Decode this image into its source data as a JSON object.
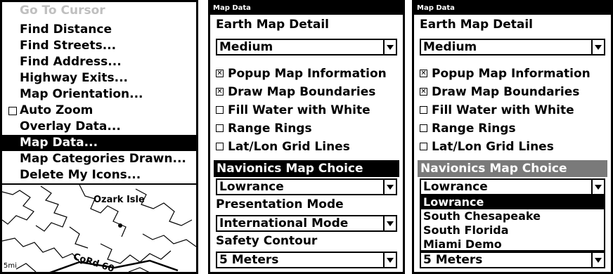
{
  "menu": {
    "items": [
      {
        "label": "Go To Cursor",
        "state": "disabled"
      },
      {
        "label": "Find Distance"
      },
      {
        "label": "Find Streets..."
      },
      {
        "label": "Find Address..."
      },
      {
        "label": "Highway Exits..."
      },
      {
        "label": "Map Orientation..."
      },
      {
        "label": "Auto Zoom",
        "checkbox": true
      },
      {
        "label": "Overlay Data..."
      },
      {
        "label": "Map Data...",
        "state": "selected"
      },
      {
        "label": "Map Categories Drawn..."
      },
      {
        "label": "Delete My Icons..."
      }
    ]
  },
  "map": {
    "place_label": "Ozark Isle",
    "road_label": "CoRd 60",
    "scale_label": "5mi"
  },
  "dialog": {
    "title": "Map Data",
    "earth_detail_label": "Earth Map Detail",
    "earth_detail_value": "Medium",
    "checkboxes": [
      {
        "label": "Popup Map Information",
        "checked": true
      },
      {
        "label": "Draw Map Boundaries",
        "checked": true
      },
      {
        "label": "Fill Water with White",
        "checked": false
      },
      {
        "label": "Range Rings",
        "checked": false
      },
      {
        "label": "Lat/Lon Grid Lines",
        "checked": false
      }
    ],
    "navionics_label": "Navionics Map Choice",
    "navionics_value": "Lowrance",
    "presentation_label": "Presentation Mode",
    "presentation_value": "International Mode",
    "safety_label": "Safety Contour",
    "safety_value": "5 Meters",
    "navionics_options": [
      "Lowrance",
      "South Chesapeake",
      "South Florida",
      "Miami Demo"
    ],
    "check_mark": "✕"
  }
}
